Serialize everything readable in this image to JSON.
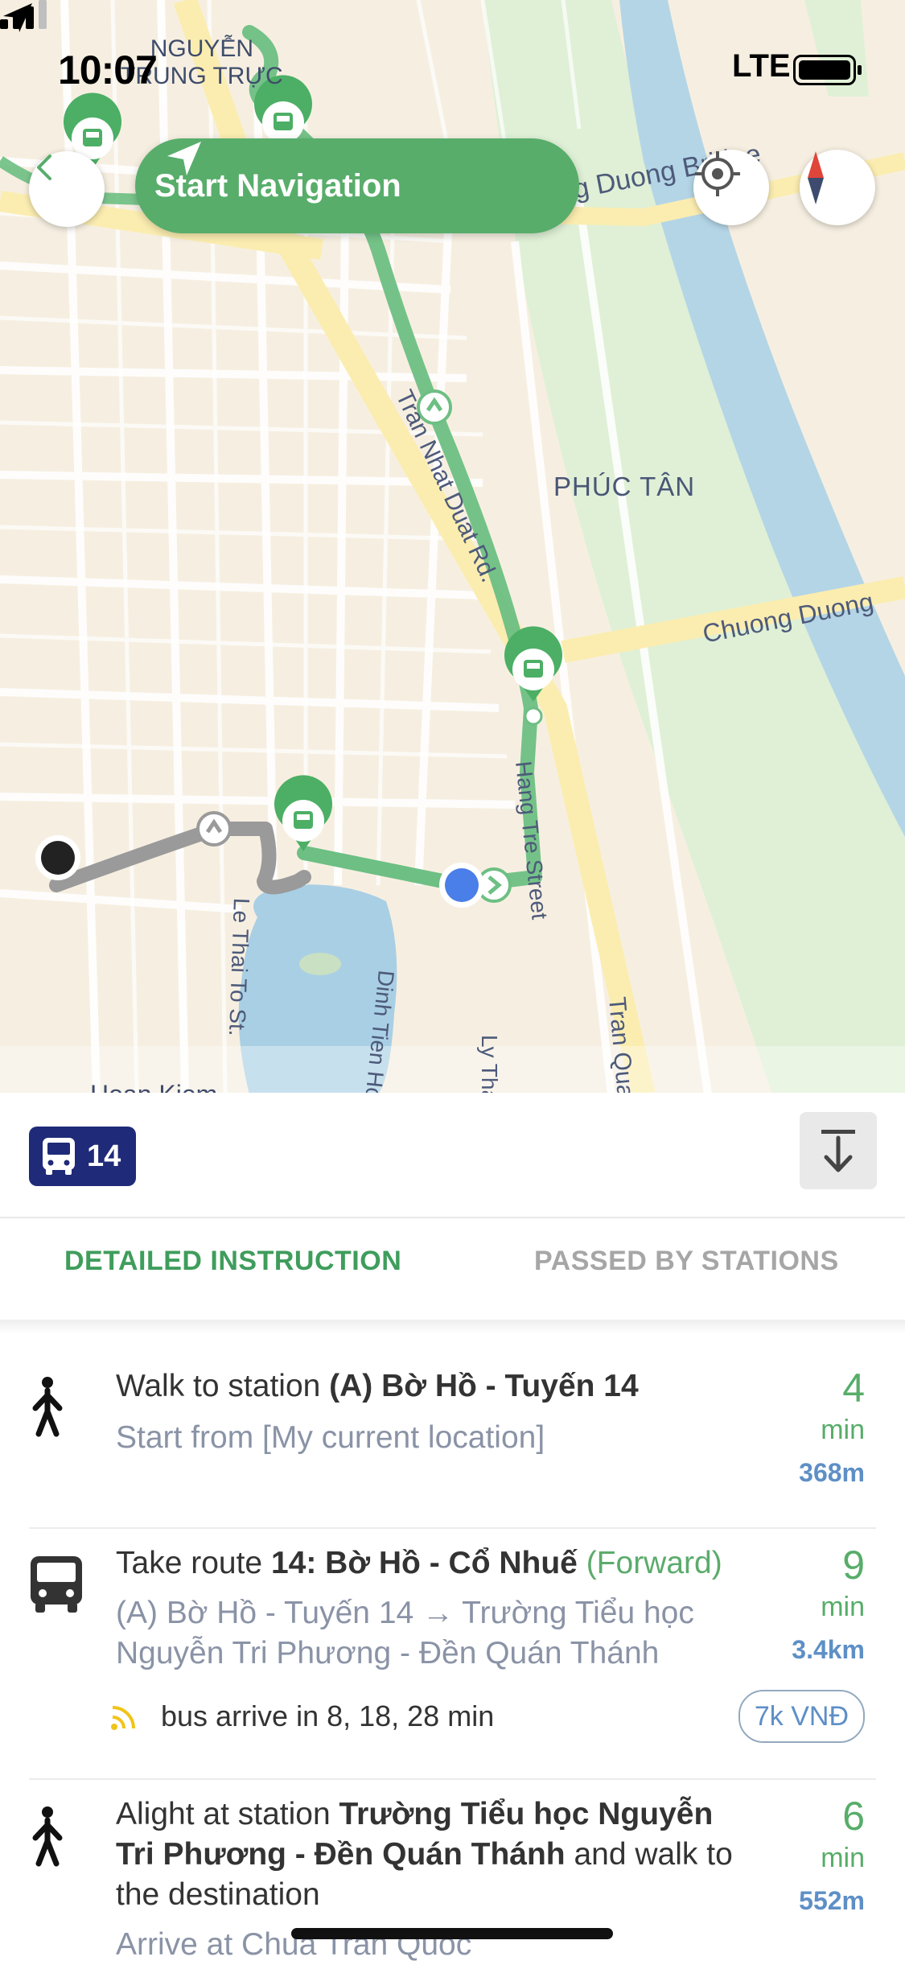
{
  "status_bar": {
    "time": "10:07",
    "network": "LTE"
  },
  "map": {
    "labels": {
      "nguyen_trung_truc": "NGUYỄN\nTRUNG TRỰC",
      "chuong_duong_bridge": "Chuong Duong Bridge",
      "phuc_tan": "PHÚC TÂN",
      "chuong_duong": "Chuong Duong",
      "tran_nhat_duat": "Tran Nhat Duat Rd.",
      "hang_tre": "Hang Tre Street",
      "le_thai_to": "Le Thai To St.",
      "hang_bai": "Dinh Tien Hoang St.",
      "ly_thai_to": "Ly Thai To",
      "tran_quang_khai": "Tran Quang Khai",
      "hoan_kiem": "Hoan Kiem"
    },
    "start_navigation": "Start Navigation"
  },
  "panel": {
    "route_number": "14",
    "tabs": [
      "DETAILED INSTRUCTION",
      "PASSED BY STATIONS"
    ],
    "steps": [
      {
        "type": "walk",
        "title_prefix": "Walk to station ",
        "title_bold": "(A) Bờ Hồ - Tuyến 14",
        "subtitle": "Start from [My current location]",
        "duration": "4",
        "unit": "min",
        "distance": "368m"
      },
      {
        "type": "bus",
        "title_prefix": "Take route ",
        "title_bold": "14: Bờ Hồ - Cổ Nhuế",
        "direction": " (Forward)",
        "subtitle": "(A) Bờ Hồ - Tuyến 14 → Trường Tiểu học Nguyễn Tri Phương - Đền Quán Thánh",
        "arrival": "bus arrive in 8, 18, 28 min",
        "price": "7k VNĐ",
        "duration": "9",
        "unit": "min",
        "distance": "3.4km"
      },
      {
        "type": "walk",
        "title_prefix": "Alight at station ",
        "title_bold": "Trường Tiểu học Nguyễn Tri Phương - Đền Quán Thánh",
        "title_suffix": " and walk to the destination",
        "subtitle": "Arrive at Chua Tran Quoc",
        "duration": "6",
        "unit": "min",
        "distance": "552m"
      }
    ]
  },
  "colors": {
    "accent_green": "#58ad6b",
    "route_navy": "#1f2a78",
    "link_blue": "#5e8fc6"
  }
}
